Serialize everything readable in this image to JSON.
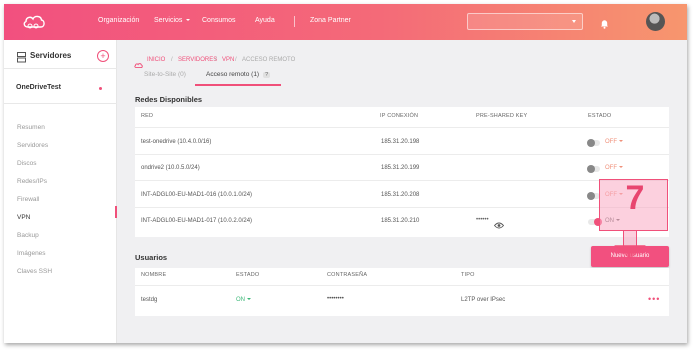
{
  "nav": {
    "items": [
      "Organización",
      "Servicios",
      "Consumos",
      "Ayuda",
      "Zona Partner"
    ]
  },
  "sidebar": {
    "title": "Servidores",
    "add_symbol": "+",
    "server": "OneDriveTest",
    "items": [
      "Resumen",
      "Servidores",
      "Discos",
      "Redes/IPs",
      "Firewall",
      "VPN",
      "Backup",
      "Imágenes",
      "Claves SSH"
    ],
    "active_item": "VPN"
  },
  "breadcrumb": {
    "home": "INICIO",
    "servers": "SERVIDORES",
    "vpn": "VPN",
    "current": "ACCESO REMOTO",
    "sep": "/"
  },
  "tabs": {
    "site_to_site": "Site-to-Site (0)",
    "remote": "Acceso remoto (1)",
    "remote_badge": "?"
  },
  "networks": {
    "title": "Redes Disponibles",
    "headers": {
      "red": "RED",
      "ip": "IP CONEXIÓN",
      "psk": "PRE-SHARED KEY",
      "estado": "ESTADO"
    },
    "rows": [
      {
        "name": "test-onedrive (10.4.0.0/16)",
        "ip": "185.31.20.198",
        "psk": "",
        "state": "OFF"
      },
      {
        "name": "ondrive2 (10.0.5.0/24)",
        "ip": "185.31.20.199",
        "psk": "",
        "state": "OFF"
      },
      {
        "name": "INT-ADGL00-EU-MAD1-016 (10.0.1.0/24)",
        "ip": "185.31.20.208",
        "psk": "",
        "state": "OFF"
      },
      {
        "name": "INT-ADGL00-EU-MAD1-017 (10.0.2.0/24)",
        "ip": "185.31.20.210",
        "psk": "••••••",
        "state": "ON"
      }
    ]
  },
  "users": {
    "title": "Usuarios",
    "new_button": "Nuevo usuario",
    "headers": {
      "nombre": "NOMBRE",
      "estado": "ESTADO",
      "contrasena": "CONTRASEÑA",
      "tipo": "TIPO"
    },
    "rows": [
      {
        "name": "testdg",
        "state": "ON",
        "password": "••••••••",
        "type": "L2TP over IPsec",
        "more": "•••"
      }
    ]
  },
  "annotation": {
    "number": "7"
  },
  "colors": {
    "accent": "#f2507f",
    "gradient_end": "#f7966e",
    "off": "#f0907a"
  }
}
